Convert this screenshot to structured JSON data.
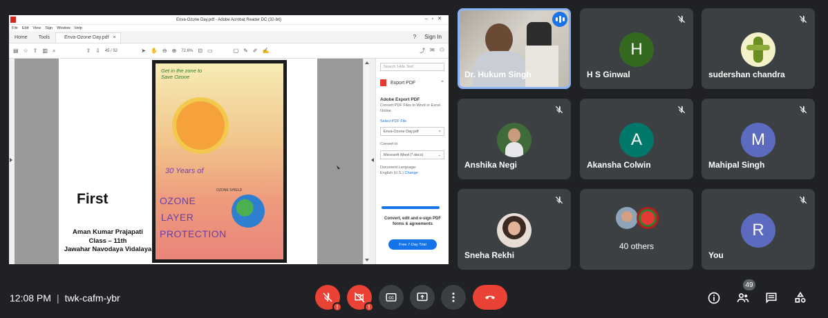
{
  "acrobat": {
    "window_title": "Enva-Ozone Day.pdf - Adobe Acrobat Reader DC (32-bit)",
    "menu": [
      "File",
      "Edit",
      "View",
      "Sign",
      "Window",
      "Help"
    ],
    "tabs": {
      "home": "Home",
      "tools": "Tools",
      "document": "Enva-Ozone Day.pdf"
    },
    "sign_in": "Sign In",
    "page_indicator": "45 / 52",
    "zoom": "72.6%",
    "document": {
      "placing": "First",
      "student_name": "Aman Kumar Prajapati",
      "student_class": "Class – 11th",
      "school": "Jawahar Navodaya Vidalaya",
      "poster": {
        "slogan": "Get in the zone to Save Ozone",
        "years": "30 Years of",
        "headline": [
          "OZONE",
          "LAYER",
          "PROTECTION"
        ],
        "shield_label": "OZONE SHIELD"
      }
    },
    "sidebar": {
      "search_placeholder": "Search 'Hide Text'",
      "export_label": "Export PDF",
      "panel_title": "Adobe Export PDF",
      "panel_desc": "Convert PDF Files to Word or Excel Online",
      "select_file": "Select PDF File",
      "selected_file": "Enva-Ozone Day.pdf",
      "convert_to_label": "Convert to",
      "convert_to_value": "Microsoft Word (*.docx)",
      "doc_language_label": "Document Language:",
      "doc_language_value": "English (U.S.)",
      "change_link": "Change",
      "promo_text": "Convert, edit and e-sign PDF forms & agreements",
      "trial_button": "Free 7-Day Trial"
    }
  },
  "participants": [
    {
      "name": "Dr. Hukum Singh",
      "type": "video",
      "speaking": true
    },
    {
      "name": "H S Ginwal",
      "initial": "H",
      "color": "#33691e",
      "muted": true
    },
    {
      "name": "sudershan chandra",
      "type": "photo",
      "muted": true
    },
    {
      "name": "Anshika Negi",
      "type": "photo",
      "muted": true
    },
    {
      "name": "Akansha Colwin",
      "initial": "A",
      "color": "#00796b",
      "muted": true
    },
    {
      "name": "Mahipal Singh",
      "initial": "M",
      "color": "#5c6bc0",
      "muted": true
    },
    {
      "name": "Sneha Rekhi",
      "type": "photo",
      "muted": true
    },
    {
      "name": "40 others",
      "type": "others"
    },
    {
      "name": "You",
      "initial": "R",
      "color": "#5c6bc0",
      "muted": true
    }
  ],
  "meeting": {
    "time": "12:08 PM",
    "code": "twk-cafm-ybr",
    "participant_count": "49"
  },
  "icons": {
    "mic_off": "mic-off-icon",
    "cam_off": "videocam-off-icon",
    "captions": "closed-caption-icon",
    "present": "present-screen-icon",
    "more": "more-vert-icon",
    "hangup": "call-end-icon",
    "info": "info-icon",
    "people": "people-icon",
    "chat": "chat-icon",
    "activities": "activities-icon"
  }
}
